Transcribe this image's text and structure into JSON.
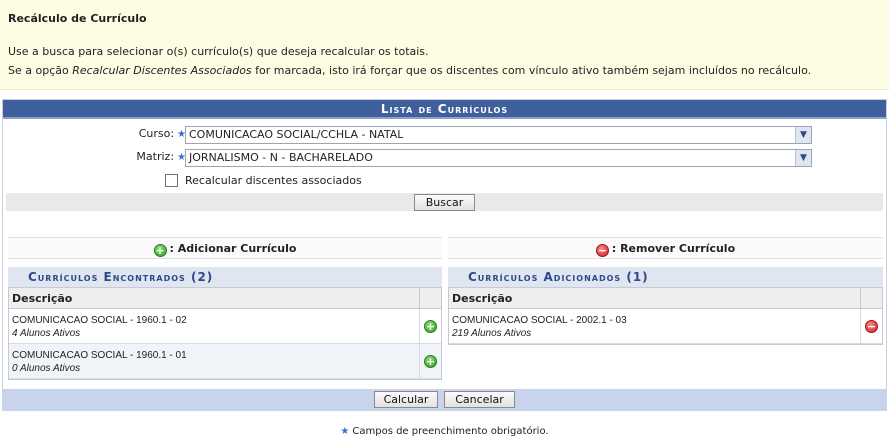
{
  "intro": {
    "title": "Recálculo de Currículo",
    "line1": "Use a busca para selecionar o(s) currículo(s) que deseja recalcular os totais.",
    "line2_prefix": "Se a opção ",
    "line2_emphasis": "Recalcular Discentes Associados",
    "line2_suffix": " for marcada, isto irá forçar que os discentes com vínculo ativo também sejam incluídos no recálculo."
  },
  "panel": {
    "title": "Lista de Currículos",
    "curso_label": "Curso:",
    "curso_value": "COMUNICACAO SOCIAL/CCHLA - NATAL",
    "matriz_label": "Matriz:",
    "matriz_value": "JORNALISMO - N - BACHARELADO",
    "checkbox_label": "Recalcular discentes associados",
    "buscar_label": "Buscar"
  },
  "left": {
    "action": ": Adicionar Currículo",
    "subtitle": "Currículos Encontrados (2)",
    "header": "Descrição",
    "rows": [
      {
        "name": "COMUNICACAO SOCIAL - 1960.1 - 02",
        "sub": "4 Alunos Ativos"
      },
      {
        "name": "COMUNICACAO SOCIAL - 1960.1 - 01",
        "sub": "0 Alunos Ativos"
      }
    ]
  },
  "right": {
    "action": ": Remover Currículo",
    "subtitle": "Currículos Adicionados (1)",
    "header": "Descrição",
    "rows": [
      {
        "name": "COMUNICACAO SOCIAL - 2002.1 - 03",
        "sub": "219 Alunos Ativos"
      }
    ]
  },
  "buttons": {
    "calcular": "Calcular",
    "cancelar": "Cancelar"
  },
  "required_note": "Campos de preenchimento obrigatório.",
  "icons": {
    "required": "star-icon",
    "add": "plus-circle-icon",
    "remove": "minus-circle-icon",
    "dropdown": "chevron-down-icon"
  },
  "colors": {
    "header_blue": "#3f5f9d",
    "intro_bg": "#fdfde4",
    "subheader_bg": "#dfe6f2",
    "footer_bg": "#c8d4ec"
  }
}
